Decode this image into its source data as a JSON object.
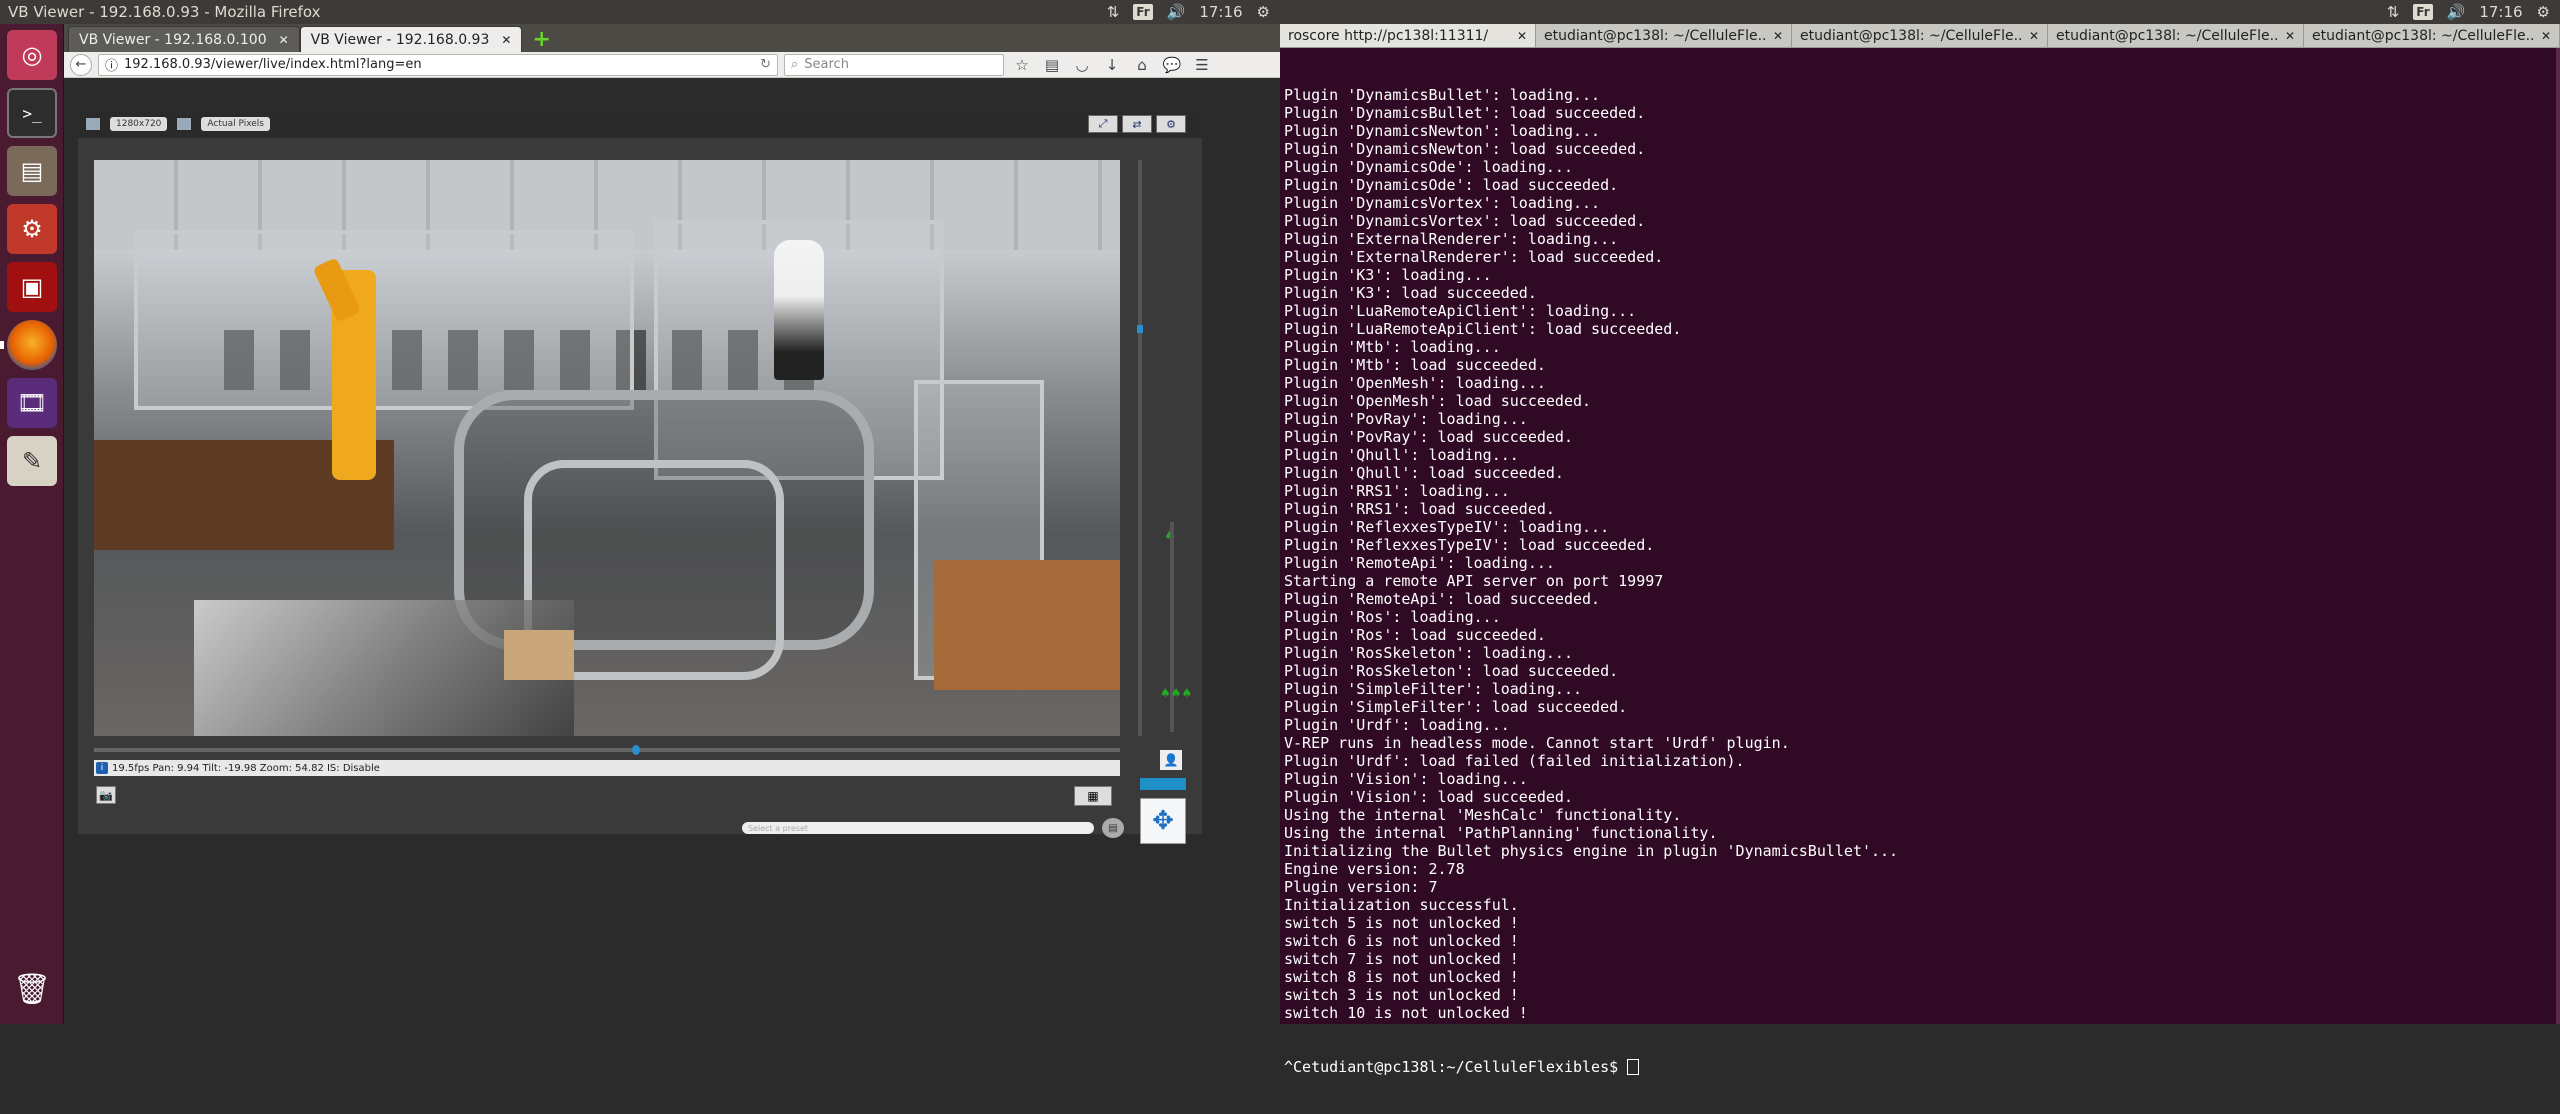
{
  "system": {
    "left_title": "VB Viewer - 192.168.0.93 - Mozilla Firefox",
    "kb_layout": "Fr",
    "time": "17:16"
  },
  "firefox": {
    "tabs": [
      {
        "label": "VB Viewer - 192.168.0.100"
      },
      {
        "label": "VB Viewer - 192.168.0.93"
      }
    ],
    "url": "192.168.0.93/viewer/live/index.html?lang=en",
    "search_placeholder": "Search"
  },
  "viewer": {
    "resolution": "1280x720",
    "view_mode": "Actual Pixels",
    "status_text": "19.5fps Pan: 9.94 Tilt: -19.98 Zoom: 54.82 IS: Disable",
    "preset_placeholder": "Select a preset"
  },
  "terminal": {
    "tabs": [
      {
        "label": "roscore http://pc138l:11311/"
      },
      {
        "label": "etudiant@pc138l: ~/CelluleFle..."
      },
      {
        "label": "etudiant@pc138l: ~/CelluleFle..."
      },
      {
        "label": "etudiant@pc138l: ~/CelluleFle..."
      },
      {
        "label": "etudiant@pc138l: ~/CelluleFle..."
      }
    ],
    "lines": [
      "Plugin 'DynamicsBullet': loading...",
      "Plugin 'DynamicsBullet': load succeeded.",
      "Plugin 'DynamicsNewton': loading...",
      "Plugin 'DynamicsNewton': load succeeded.",
      "Plugin 'DynamicsOde': loading...",
      "Plugin 'DynamicsOde': load succeeded.",
      "Plugin 'DynamicsVortex': loading...",
      "Plugin 'DynamicsVortex': load succeeded.",
      "Plugin 'ExternalRenderer': loading...",
      "Plugin 'ExternalRenderer': load succeeded.",
      "Plugin 'K3': loading...",
      "Plugin 'K3': load succeeded.",
      "Plugin 'LuaRemoteApiClient': loading...",
      "Plugin 'LuaRemoteApiClient': load succeeded.",
      "Plugin 'Mtb': loading...",
      "Plugin 'Mtb': load succeeded.",
      "Plugin 'OpenMesh': loading...",
      "Plugin 'OpenMesh': load succeeded.",
      "Plugin 'PovRay': loading...",
      "Plugin 'PovRay': load succeeded.",
      "Plugin 'Qhull': loading...",
      "Plugin 'Qhull': load succeeded.",
      "Plugin 'RRS1': loading...",
      "Plugin 'RRS1': load succeeded.",
      "Plugin 'ReflexxesTypeIV': loading...",
      "Plugin 'ReflexxesTypeIV': load succeeded.",
      "Plugin 'RemoteApi': loading...",
      "Starting a remote API server on port 19997",
      "Plugin 'RemoteApi': load succeeded.",
      "Plugin 'Ros': loading...",
      "Plugin 'Ros': load succeeded.",
      "Plugin 'RosSkeleton': loading...",
      "Plugin 'RosSkeleton': load succeeded.",
      "Plugin 'SimpleFilter': loading...",
      "Plugin 'SimpleFilter': load succeeded.",
      "Plugin 'Urdf': loading...",
      "V-REP runs in headless mode. Cannot start 'Urdf' plugin.",
      "Plugin 'Urdf': load failed (failed initialization).",
      "Plugin 'Vision': loading...",
      "Plugin 'Vision': load succeeded.",
      "Using the internal 'MeshCalc' functionality.",
      "Using the internal 'PathPlanning' functionality.",
      "Initializing the Bullet physics engine in plugin 'DynamicsBullet'...",
      "Engine version: 2.78",
      "Plugin version: 7",
      "Initialization successful.",
      "switch 5 is not unlocked !",
      "switch 6 is not unlocked !",
      "switch 7 is not unlocked !",
      "switch 8 is not unlocked !",
      "switch 3 is not unlocked !",
      "switch 10 is not unlocked !"
    ],
    "prompt": "^Cetudiant@pc138l:~/CelluleFlexibles$ "
  }
}
